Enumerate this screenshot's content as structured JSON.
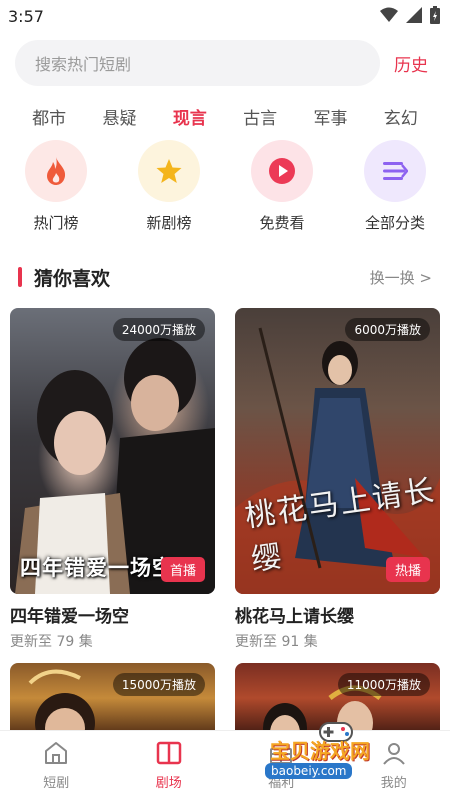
{
  "status": {
    "time": "3:57"
  },
  "search": {
    "placeholder": "搜索热门短剧",
    "history_label": "历史"
  },
  "categories": [
    {
      "label": "都市",
      "active": false
    },
    {
      "label": "悬疑",
      "active": false
    },
    {
      "label": "现言",
      "active": true
    },
    {
      "label": "古言",
      "active": false
    },
    {
      "label": "军事",
      "active": false
    },
    {
      "label": "玄幻",
      "active": false
    }
  ],
  "quick_entries": [
    {
      "label": "热门榜",
      "icon": "flame-icon",
      "bg": "#fde8e6",
      "color": "#ef5b3b"
    },
    {
      "label": "新剧榜",
      "icon": "star-icon",
      "bg": "#fdf4dd",
      "color": "#f4b51c"
    },
    {
      "label": "免费看",
      "icon": "play-icon",
      "bg": "#fde3e7",
      "color": "#ec3a56"
    },
    {
      "label": "全部分类",
      "icon": "list-icon",
      "bg": "#efe8fd",
      "color": "#8d62f0"
    }
  ],
  "section": {
    "title": "猜你喜欢",
    "more_label": "换一换 >"
  },
  "cards": [
    {
      "views": "24000万播放",
      "badge": "首播",
      "overlay": "四年错爱一场空",
      "name": "四年错爱一场空",
      "sub": "更新至 79 集"
    },
    {
      "views": "6000万播放",
      "badge": "热播",
      "overlay": "桃花马上请长缨",
      "name": "桃花马上请长缨",
      "sub": "更新至 91 集"
    },
    {
      "views": "15000万播放"
    },
    {
      "views": "11000万播放"
    }
  ],
  "nav": [
    {
      "label": "短剧",
      "icon": "home-icon",
      "active": false
    },
    {
      "label": "剧场",
      "icon": "theater-icon",
      "active": true
    },
    {
      "label": "福利",
      "icon": "gift-icon",
      "active": false
    },
    {
      "label": "我的",
      "icon": "user-icon",
      "active": false
    }
  ],
  "watermark": {
    "brand": "宝贝游戏网",
    "site": "baobeiy.com"
  },
  "colors": {
    "accent": "#e8344e"
  }
}
